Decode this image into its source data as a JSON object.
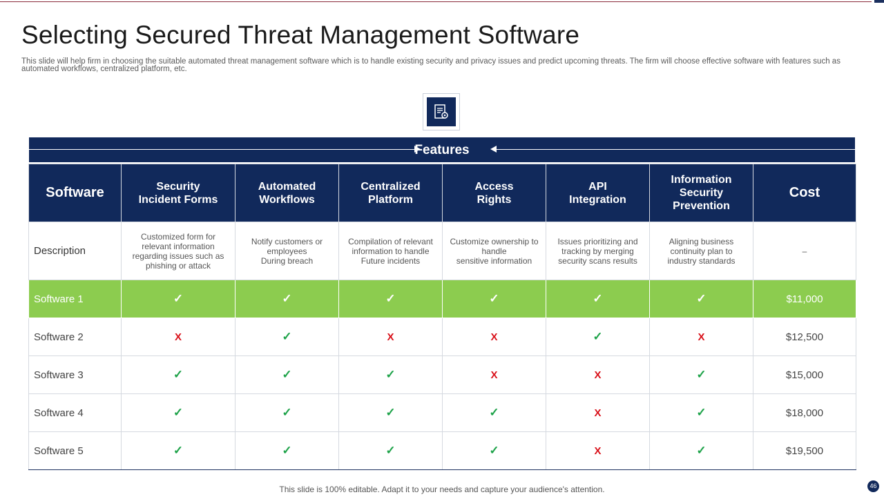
{
  "slide": {
    "title": "Selecting Secured Threat Management Software",
    "subtitle": "This slide will help firm in choosing the suitable automated threat management software which is to handle existing security and privacy issues and predict upcoming threats. The firm will choose effective software with features such as automated workflows, centralized platform, etc.",
    "features_label": "Features",
    "footer": "This slide is 100% editable. Adapt it to your needs and capture your audience's attention.",
    "page_number": "46",
    "icon": "document-settings-icon"
  },
  "colors": {
    "navy": "#11295b",
    "highlight_green": "#8ccc4f",
    "check_green": "#1fa34a",
    "cross_red": "#d9121b"
  },
  "table": {
    "headers": [
      "Software",
      "Security\nIncident Forms",
      "Automated\nWorkflows",
      "Centralized\nPlatform",
      "Access\nRights",
      "API\nIntegration",
      "Information\nSecurity\nPrevention",
      "Cost"
    ],
    "description": {
      "label": "Description",
      "cells": [
        "Customized form for\nrelevant information\nregarding issues such as\nphishing or attack",
        "Notify customers or\nemployees\nDuring breach",
        "Compilation of relevant\ninformation to handle\nFuture incidents",
        "Customize ownership to\nhandle\nsensitive information",
        "Issues prioritizing and\ntracking by merging\nsecurity scans results",
        "Aligning business\ncontinuity plan to\nindustry standards",
        "–"
      ]
    },
    "rows": [
      {
        "name": "Software 1",
        "marks": [
          "✓",
          "✓",
          "✓",
          "✓",
          "✓",
          "✓"
        ],
        "cost": "$11,000"
      },
      {
        "name": "Software 2",
        "marks": [
          "X",
          "✓",
          "X",
          "X",
          "✓",
          "X"
        ],
        "cost": "$12,500"
      },
      {
        "name": "Software 3",
        "marks": [
          "✓",
          "✓",
          "✓",
          "X",
          "X",
          "✓"
        ],
        "cost": "$15,000"
      },
      {
        "name": "Software 4",
        "marks": [
          "✓",
          "✓",
          "✓",
          "✓",
          "X",
          "✓"
        ],
        "cost": "$18,000"
      },
      {
        "name": "Software 5",
        "marks": [
          "✓",
          "✓",
          "✓",
          "✓",
          "X",
          "✓"
        ],
        "cost": "$19,500"
      }
    ]
  }
}
